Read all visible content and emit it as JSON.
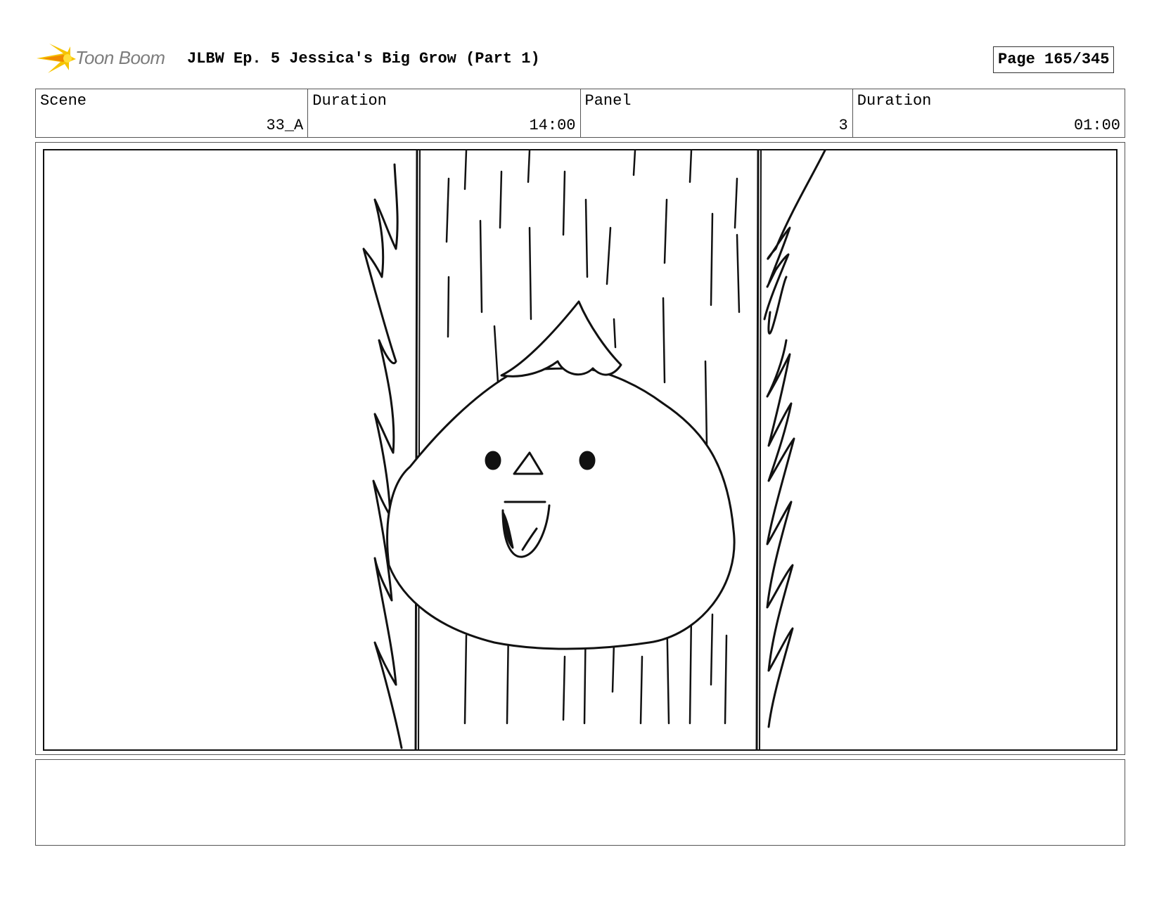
{
  "header": {
    "logo_text": "Toon Boom",
    "title": "JLBW Ep. 5 Jessica's Big Grow (Part 1)",
    "page": "Page 165/345"
  },
  "info": {
    "scene_label": "Scene",
    "scene_value": "33_A",
    "scene_duration_label": "Duration",
    "scene_duration_value": "14:00",
    "panel_label": "Panel",
    "panel_value": "3",
    "panel_duration_label": "Duration",
    "panel_duration_value": "01:00"
  },
  "notes": {
    "text": ""
  }
}
